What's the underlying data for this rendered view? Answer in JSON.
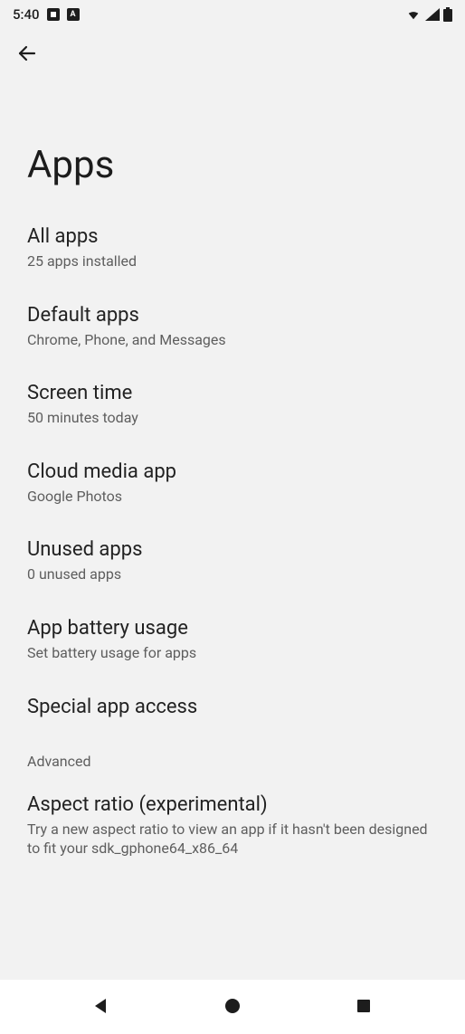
{
  "status_bar": {
    "time": "5:40"
  },
  "header": {
    "title": "Apps"
  },
  "rows": [
    {
      "title": "All apps",
      "sub": "25 apps installed"
    },
    {
      "title": "Default apps",
      "sub": "Chrome, Phone, and Messages"
    },
    {
      "title": "Screen time",
      "sub": "50 minutes today"
    },
    {
      "title": "Cloud media app",
      "sub": "Google Photos"
    },
    {
      "title": "Unused apps",
      "sub": "0 unused apps"
    },
    {
      "title": "App battery usage",
      "sub": "Set battery usage for apps"
    },
    {
      "title": "Special app access",
      "sub": ""
    }
  ],
  "advanced_label": "Advanced",
  "advanced_rows": [
    {
      "title": "Aspect ratio (experimental)",
      "sub": "Try a new aspect ratio to view an app if it hasn't been designed to fit your sdk_gphone64_x86_64"
    }
  ]
}
